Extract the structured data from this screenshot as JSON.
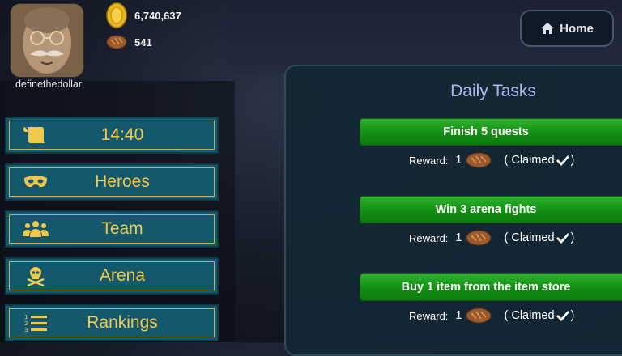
{
  "profile": {
    "username": "definethedollar"
  },
  "resources": {
    "gold": "6,740,637",
    "bread": "541"
  },
  "home_button": {
    "label": "Home"
  },
  "menu": [
    {
      "label": "14:40",
      "icon": "scroll-icon"
    },
    {
      "label": "Heroes",
      "icon": "mask-icon"
    },
    {
      "label": "Team",
      "icon": "users-icon"
    },
    {
      "label": "Arena",
      "icon": "skull-crossbones-icon"
    },
    {
      "label": "Rankings",
      "icon": "list-ol-icon"
    }
  ],
  "daily_tasks": {
    "title": "Daily Tasks",
    "tasks": [
      {
        "name": "Finish 5 quests",
        "reward_label": "Reward:",
        "reward_qty": "1",
        "status": "( Claimed",
        "status_close": ")"
      },
      {
        "name": "Win 3 arena fights",
        "reward_label": "Reward:",
        "reward_qty": "1",
        "status": "( Claimed",
        "status_close": ")"
      },
      {
        "name": "Buy 1 item from the item store",
        "reward_label": "Reward:",
        "reward_qty": "1",
        "status": "( Claimed",
        "status_close": ")"
      }
    ]
  },
  "colors": {
    "menu_text": "#f0c84e",
    "task_green": "#138e13",
    "title": "#aeb6ee"
  }
}
